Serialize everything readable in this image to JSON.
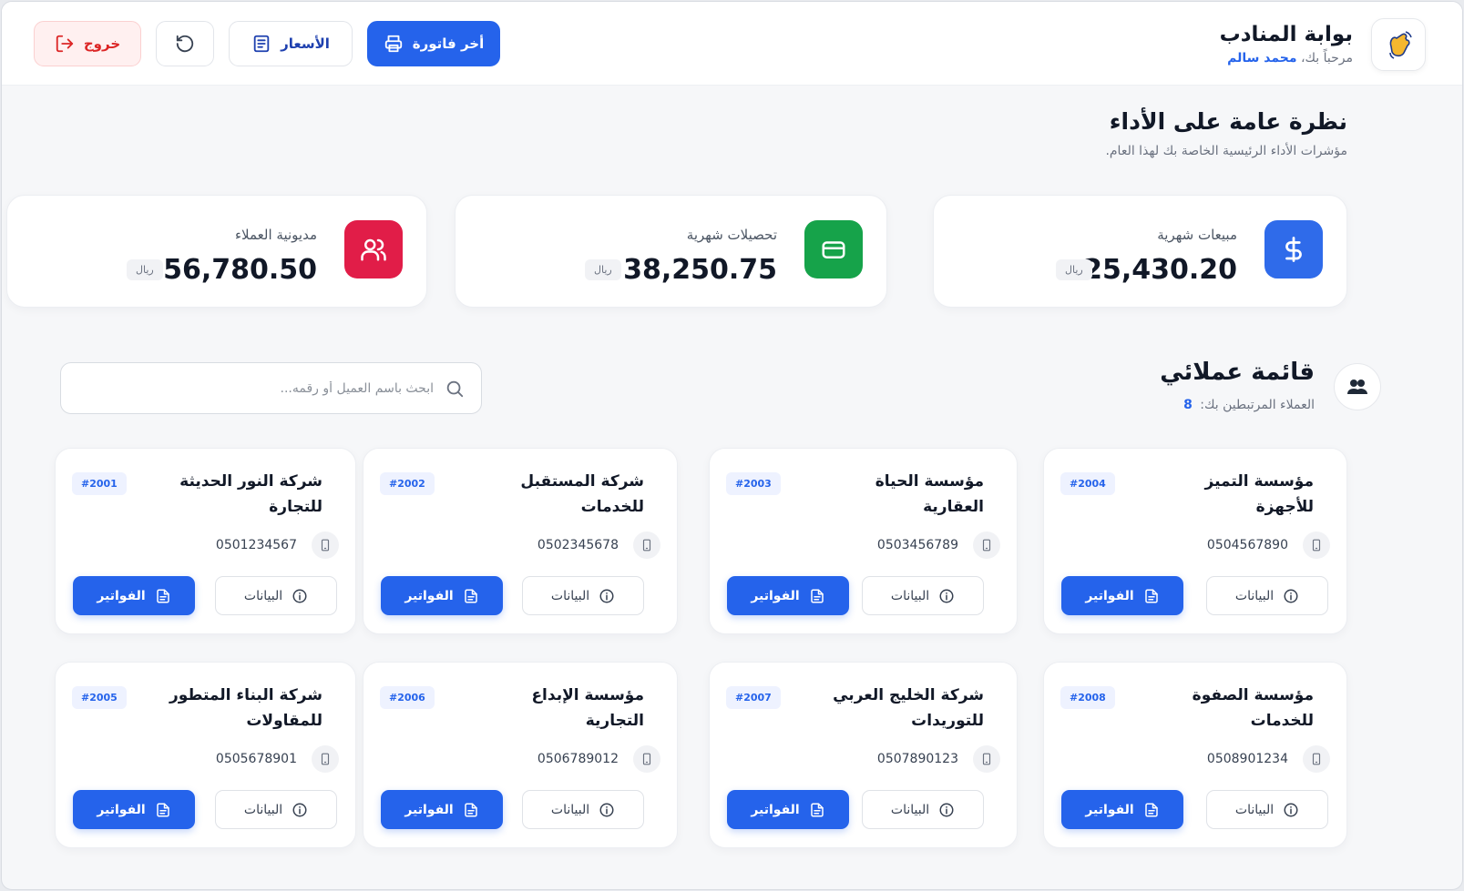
{
  "header": {
    "title": "بوابة المنادب",
    "greeting": "مرحباً بك،",
    "user_name": "محمد سالم",
    "actions": {
      "issue_invoice": "أخر فاتورة",
      "prices": "الأسعار",
      "logout": "خروج"
    }
  },
  "overview": {
    "title": "نظرة عامة على الأداء",
    "subtitle": "مؤشرات الأداء الرئيسية الخاصة بك لهذا العام."
  },
  "stats": [
    {
      "label": "مبيعات شهرية",
      "value": "25,430.20",
      "currency": "ريال",
      "color": "#2f6bea"
    },
    {
      "label": "تحصيلات شهرية",
      "value": "38,250.75",
      "currency": "ريال",
      "color": "#16a34a"
    },
    {
      "label": "مديونية العملاء",
      "value": "56,780.50",
      "currency": "ريال",
      "color": "#e11d48"
    }
  ],
  "clients": {
    "title": "قائمة عملائي",
    "subtitle": "العملاء المرتبطين بك:",
    "count": "8",
    "search_placeholder": "ابحث باسم العميل أو رقمه...",
    "info_label": "البيانات",
    "invoices_label": "الفواتير",
    "items": [
      {
        "name": "مؤسسة التميز للأجهزة",
        "id": "#2004",
        "phone": "0504567890"
      },
      {
        "name": "مؤسسة الحياة العقارية",
        "id": "#2003",
        "phone": "0503456789"
      },
      {
        "name": "شركة المستقبل للخدمات",
        "id": "#2002",
        "phone": "0502345678"
      },
      {
        "name": "شركة النور الحديثة للتجارة",
        "id": "#2001",
        "phone": "0501234567"
      },
      {
        "name": "مؤسسة الصفوة للخدمات",
        "id": "#2008",
        "phone": "0508901234"
      },
      {
        "name": "شركة الخليج العربي للتوريدات",
        "id": "#2007",
        "phone": "0507890123"
      },
      {
        "name": "مؤسسة الإبداع التجارية",
        "id": "#2006",
        "phone": "0506789012"
      },
      {
        "name": "شركة البناء المتطور للمقاولات",
        "id": "#2005",
        "phone": "0505678901"
      }
    ]
  }
}
